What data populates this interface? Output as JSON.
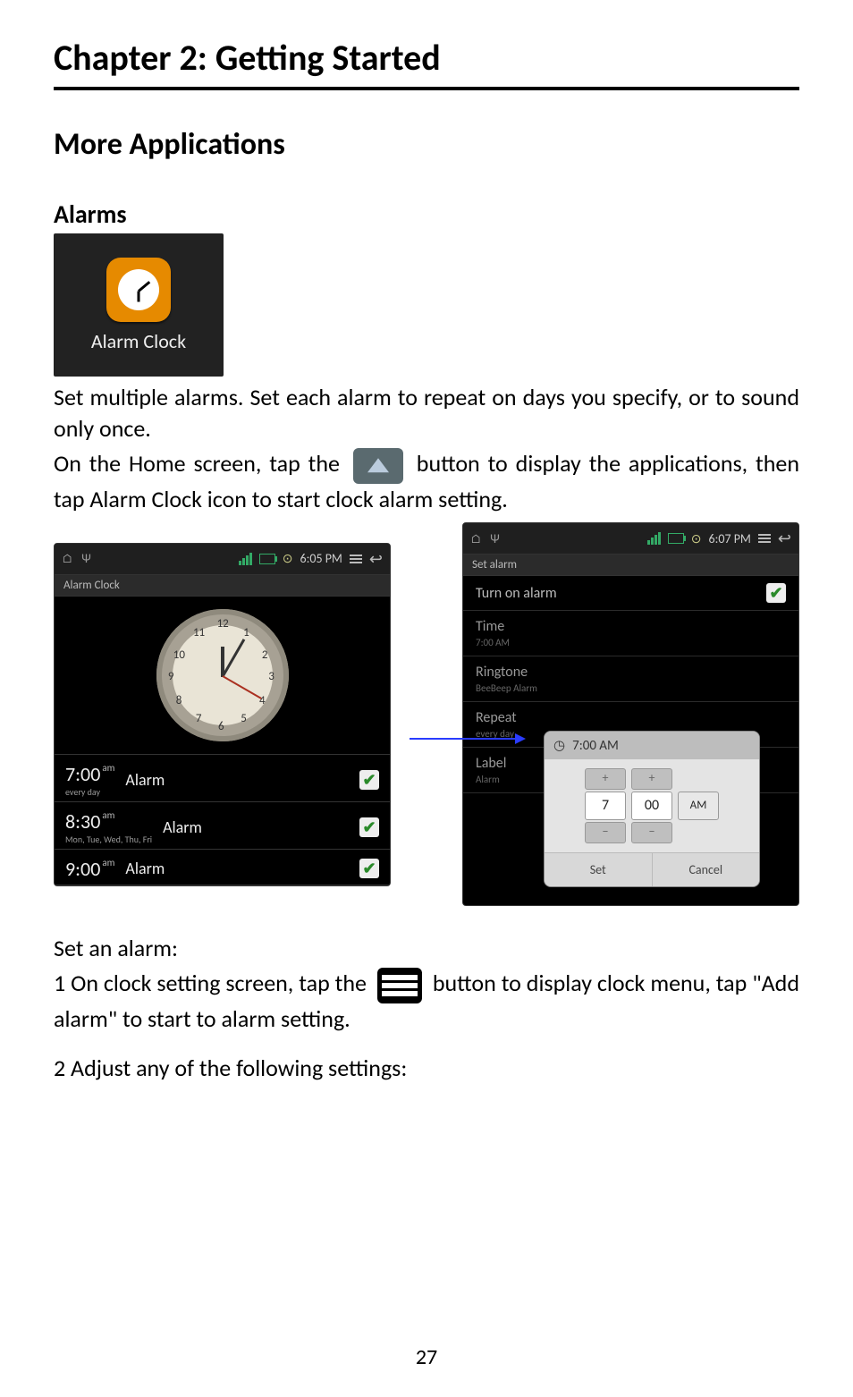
{
  "chapter_title": "Chapter 2: Getting Started",
  "section_title": "More Applications",
  "sub_title": "Alarms",
  "app_icon": {
    "label": "Alarm Clock"
  },
  "para1": "Set multiple alarms. Set each alarm to repeat on days you specify, or to sound only once.",
  "para2a": "On the Home screen, tap the ",
  "para2b": " button to display the applications, then tap Alarm Clock icon to start clock alarm setting.",
  "set_heading": "Set an alarm:",
  "step1a": "1 On clock setting screen, tap the ",
  "step1b": " button to display clock menu, tap \"Add alarm\" to start to alarm setting.",
  "step2": "2 Adjust any of the following settings:",
  "page_number": "27",
  "screenshot_left": {
    "status_time": "6:05 PM",
    "titlebar": "Alarm Clock",
    "clock_numbers": [
      "12",
      "1",
      "2",
      "3",
      "4",
      "5",
      "6",
      "7",
      "8",
      "9",
      "10",
      "11"
    ],
    "alarms": [
      {
        "time": "7:00",
        "ampm": "am",
        "label": "Alarm",
        "repeat": "every day",
        "checked": true
      },
      {
        "time": "8:30",
        "ampm": "am",
        "label": "Alarm",
        "repeat": "Mon, Tue, Wed, Thu, Fri",
        "checked": true
      },
      {
        "time": "9:00",
        "ampm": "am",
        "label": "Alarm",
        "repeat": "",
        "checked": true
      }
    ]
  },
  "screenshot_right": {
    "status_time": "6:07 PM",
    "titlebar": "Set alarm",
    "rows": {
      "turn_on": "Turn on alarm",
      "time_label": "Time",
      "time_value": "7:00 AM",
      "ringtone_label": "Ringtone",
      "ringtone_value": "BeeBeep Alarm",
      "repeat_label": "Repeat",
      "repeat_value": "every day",
      "label_label": "Label",
      "label_value": "Alarm"
    },
    "dialog": {
      "title": "7:00 AM",
      "hour": "7",
      "minute": "00",
      "ampm": "AM",
      "set": "Set",
      "cancel": "Cancel"
    }
  }
}
